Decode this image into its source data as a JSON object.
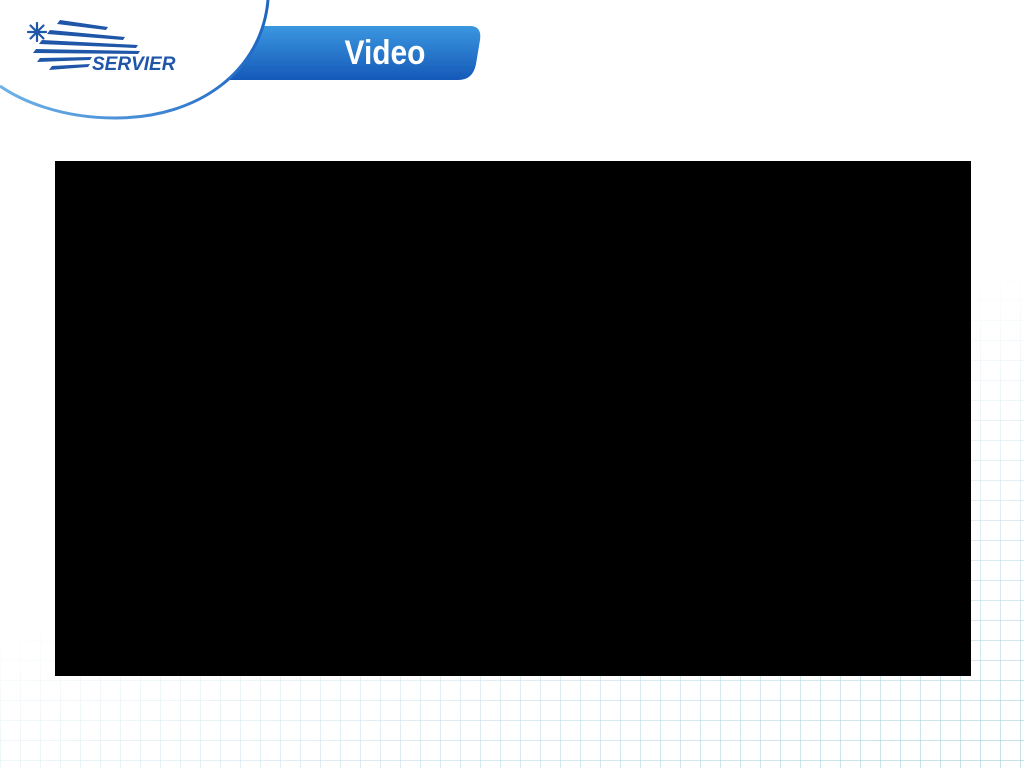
{
  "slide": {
    "title": "Video",
    "logo_text": "SERVIER"
  },
  "colors": {
    "brand_blue": "#1f56a8",
    "tab_blue_light": "#3b97e0",
    "tab_blue_dark": "#1559b8",
    "video_background": "#000000",
    "grid_line": "#96c8d7"
  },
  "icons": {
    "logo_mark": "servier-star-stripes-icon"
  }
}
